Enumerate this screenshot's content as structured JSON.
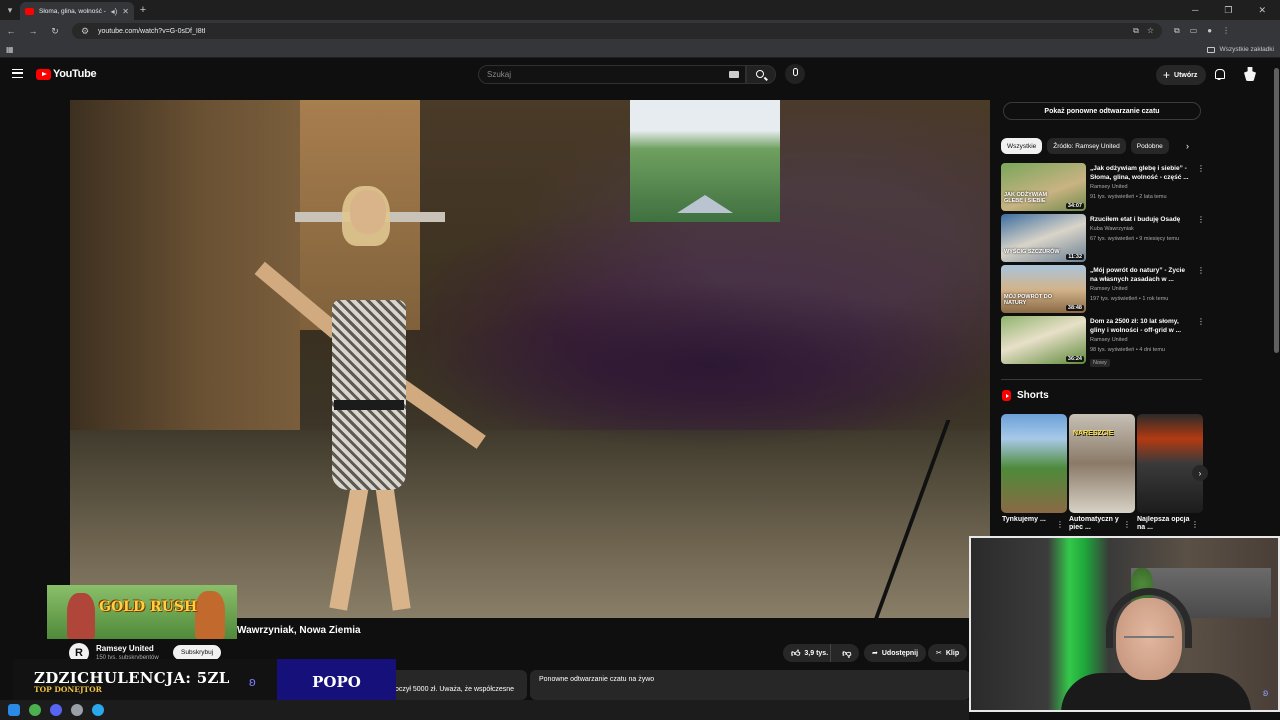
{
  "browser": {
    "tab_title": "Słoma, glina, wolność - cz.",
    "url": "youtube.com/watch?v=G-0sDf_I8tI",
    "all_bookmarks": "Wszystkie zakładki"
  },
  "youtube": {
    "logo_text": "YouTube",
    "search_placeholder": "Szukaj",
    "create_label": "Utwórz"
  },
  "video": {
    "title": "Wawrzyniak, Nowa Ziemia",
    "channel_name": "Ramsey United",
    "channel_initial": "R",
    "subs": "150 tys. subskrybentów",
    "subscribe_label": "Subskrybuj",
    "likes": "3,9 tys.",
    "share_label": "Udostępnij",
    "clip_label": "Klip",
    "description_snippet": "oczył 5000 zł. Uważa, że współczesne",
    "replay_card_title": "Ponowne odtwarzanie czatu na żywo"
  },
  "overlays": {
    "gold_rush": "GOLD RUSH",
    "donate_title": "ZDZICHULENCJA: 5ZL",
    "donate_sub": "TOP DONEJTOR",
    "donate_name": "POPO"
  },
  "sidebar": {
    "chat_replay_button": "Pokaż ponowne odtwarzanie czatu",
    "chips": [
      "Wszystkie",
      "Źródło: Ramsey United",
      "Podobne"
    ],
    "recommendations": [
      {
        "title": "„Jak odżywiam glebę i siebie” - Słoma, glina, wolność - część ...",
        "channel": "Ramsey United",
        "meta": "91 tys. wyświetleń • 2 lata temu",
        "duration": "34:07",
        "thumb_text": "JAK ODŻYWIAM GLEBĘ I SIEBIE",
        "badge": ""
      },
      {
        "title": "Rzuciłem etat i buduję Osadę",
        "channel": "Kuba Wawrzyniak",
        "meta": "67 tys. wyświetleń • 9 miesięcy temu",
        "duration": "11:32",
        "thumb_text": "WYŚCIG SZCZURÓW",
        "badge": ""
      },
      {
        "title": "„Mój powrót do natury” - Życie na własnych zasadach w ...",
        "channel": "Ramsey United",
        "meta": "197 tys. wyświetleń • 1 rok temu",
        "duration": "38:48",
        "thumb_text": "MÓJ POWRÓT DO NATURY",
        "badge": ""
      },
      {
        "title": "Dom za 2500 zł: 10 lat słomy, gliny i wolności - off-grid w ...",
        "channel": "Ramsey United",
        "meta": "98 tys. wyświetleń • 4 dni temu",
        "duration": "36:24",
        "thumb_text": "",
        "badge": "Nowy"
      }
    ],
    "shorts_heading": "Shorts",
    "shorts": [
      {
        "title": "Tynkujemy ...",
        "overlay": ""
      },
      {
        "title": "Automatyczn y piec ...",
        "overlay": "NARESZCIE"
      },
      {
        "title": "Najlepsza opcja na ...",
        "overlay": ""
      }
    ]
  }
}
